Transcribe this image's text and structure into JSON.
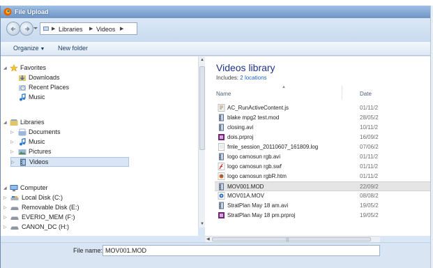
{
  "window": {
    "title": "File Upload"
  },
  "address": {
    "crumbs": [
      "Libraries",
      "Videos"
    ]
  },
  "toolbar": {
    "organize": "Organize",
    "new_folder": "New folder"
  },
  "nav": {
    "favorites": "Favorites",
    "downloads": "Downloads",
    "recent_places": "Recent Places",
    "music_fav": "Music",
    "libraries": "Libraries",
    "documents": "Documents",
    "music": "Music",
    "pictures": "Pictures",
    "videos": "Videos",
    "computer": "Computer",
    "local_disk": "Local Disk (C:)",
    "removable_disk": "Removable Disk (E:)",
    "everio": "EVERIO_MEM (F:)",
    "canon": "CANON_DC (H:)"
  },
  "library": {
    "title": "Videos library",
    "includes_prefix": "Includes:",
    "includes_link": "2 locations"
  },
  "columns": {
    "name": "Name",
    "date": "Date"
  },
  "files": [
    {
      "name": "AC_RunActiveContent.js",
      "date": "01/11/2",
      "icon": "script-file-icon"
    },
    {
      "name": "blake mpg2 test.mod",
      "date": "28/05/2",
      "icon": "video-file-icon"
    },
    {
      "name": "closing.avi",
      "date": "10/11/2",
      "icon": "video-file-icon"
    },
    {
      "name": "dois.prproj",
      "date": "16/09/2",
      "icon": "premiere-project-icon"
    },
    {
      "name": "fmle_session_20110607_161809.log",
      "date": "07/06/2",
      "icon": "log-file-icon"
    },
    {
      "name": "logo camosun rgb.avi",
      "date": "01/11/2",
      "icon": "video-file-icon"
    },
    {
      "name": "logo camosun rgb.swf",
      "date": "01/11/2",
      "icon": "flash-file-icon"
    },
    {
      "name": "logo camosun rgbR.htm",
      "date": "01/11/2",
      "icon": "html-file-icon"
    },
    {
      "name": "MOV001.MOD",
      "date": "22/09/2",
      "icon": "video-file-icon"
    },
    {
      "name": "MOV01A.MOV",
      "date": "08/08/2",
      "icon": "quicktime-file-icon"
    },
    {
      "name": "StratPlan May 18 am.avi",
      "date": "19/05/2",
      "icon": "video-file-icon"
    },
    {
      "name": "StratPlan May 18 pm.prproj",
      "date": "19/05/2",
      "icon": "premiere-project-icon"
    }
  ],
  "footer": {
    "file_name_label": "File name:",
    "file_name_value": "MOV001.MOD"
  }
}
